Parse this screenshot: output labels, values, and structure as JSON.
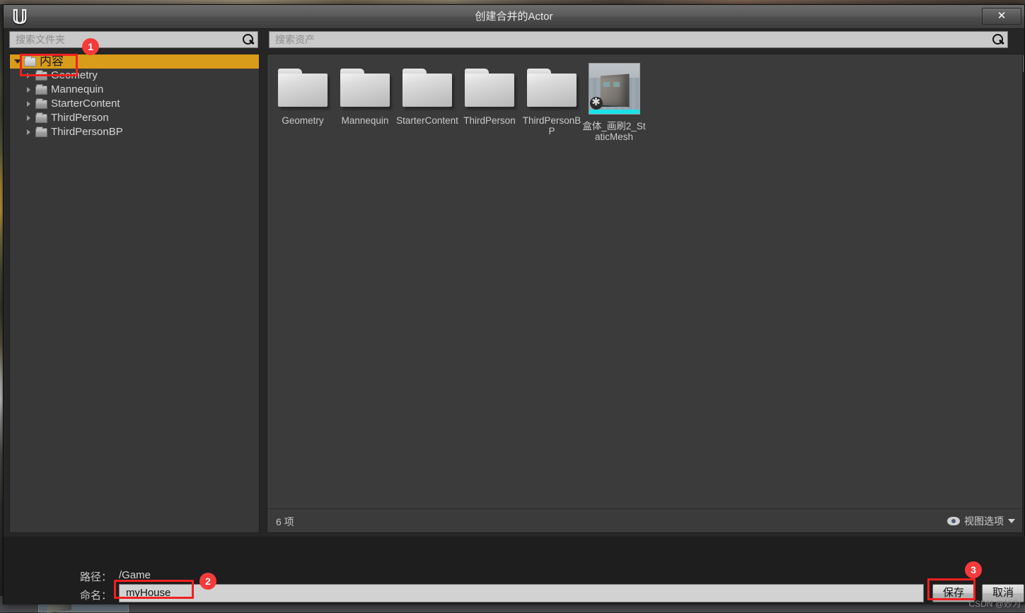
{
  "window": {
    "title": "创建合并的Actor",
    "close_label": "✕",
    "logo": "unreal-engine-logo"
  },
  "search": {
    "folder_placeholder": "搜索文件夹",
    "asset_placeholder": "搜索资产",
    "folder_icon": "search-icon",
    "asset_icon": "search-icon",
    "user_icon": "user-icon"
  },
  "tree": {
    "items": [
      {
        "label": "内容",
        "depth": 0,
        "selected": true,
        "expanded": true
      },
      {
        "label": "Geometry",
        "depth": 1,
        "selected": false,
        "expanded": false
      },
      {
        "label": "Mannequin",
        "depth": 1,
        "selected": false,
        "expanded": false
      },
      {
        "label": "StarterContent",
        "depth": 1,
        "selected": false,
        "expanded": false
      },
      {
        "label": "ThirdPerson",
        "depth": 1,
        "selected": false,
        "expanded": false
      },
      {
        "label": "ThirdPersonBP",
        "depth": 1,
        "selected": false,
        "expanded": false
      }
    ]
  },
  "assets": {
    "items": [
      {
        "label": "Geometry",
        "kind": "folder"
      },
      {
        "label": "Mannequin",
        "kind": "folder"
      },
      {
        "label": "StarterContent",
        "kind": "folder"
      },
      {
        "label": "ThirdPerson",
        "kind": "folder"
      },
      {
        "label": "ThirdPersonBP",
        "kind": "folder"
      },
      {
        "label": "盒体_画刷2_StaticMesh",
        "kind": "staticmesh"
      }
    ],
    "status_count": "6 项",
    "view_options_label": "视图选项",
    "view_options_icon": "eye-icon"
  },
  "form": {
    "path_label": "路径：",
    "path_value": "/Game",
    "name_label": "命名：",
    "name_value": "myHouse",
    "save_label": "保存",
    "cancel_label": "取消"
  },
  "annotations": {
    "badges": [
      "1",
      "2",
      "3"
    ]
  },
  "watermark": "CSDN @妙为",
  "colors": {
    "selection": "#d89c1a",
    "annotation": "#f02020",
    "badge": "#f73a3a",
    "panel_bg": "#3b3b3b",
    "window_bg": "#262626"
  }
}
